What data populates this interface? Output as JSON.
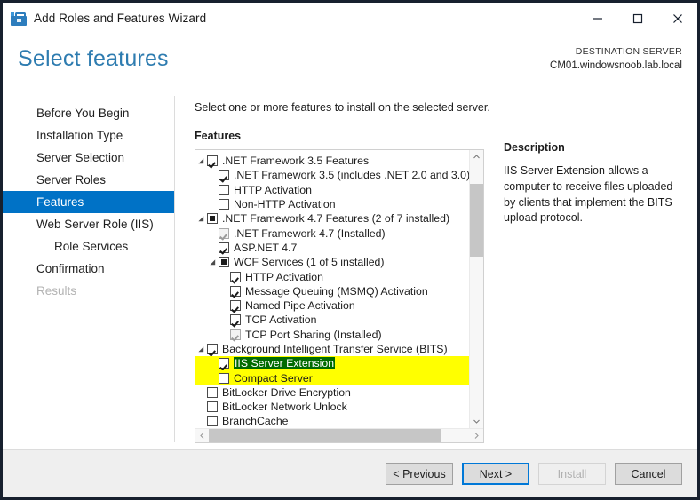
{
  "titlebar": {
    "title": "Add Roles and Features Wizard",
    "icon": "wizard-toolbox-icon",
    "minimize_label": "—",
    "maximize_label": "□",
    "close_label": "✕"
  },
  "header": {
    "page_title": "Select features",
    "destination_label": "DESTINATION SERVER",
    "destination_value": "CM01.windowsnoob.lab.local"
  },
  "nav": {
    "items": [
      {
        "label": "Before You Begin",
        "state": "normal",
        "indent": 0
      },
      {
        "label": "Installation Type",
        "state": "normal",
        "indent": 0
      },
      {
        "label": "Server Selection",
        "state": "normal",
        "indent": 0
      },
      {
        "label": "Server Roles",
        "state": "normal",
        "indent": 0
      },
      {
        "label": "Features",
        "state": "selected",
        "indent": 0
      },
      {
        "label": "Web Server Role (IIS)",
        "state": "normal",
        "indent": 0
      },
      {
        "label": "Role Services",
        "state": "normal",
        "indent": 1
      },
      {
        "label": "Confirmation",
        "state": "normal",
        "indent": 0
      },
      {
        "label": "Results",
        "state": "disabled",
        "indent": 0
      }
    ]
  },
  "main": {
    "instruction": "Select one or more features to install on the selected server.",
    "features_label": "Features",
    "tree": [
      {
        "label": ".NET Framework 3.5 Features",
        "checkbox": "checked",
        "indent": 0,
        "expander": "expanded"
      },
      {
        "label": ".NET Framework 3.5 (includes .NET 2.0 and 3.0)",
        "checkbox": "checked",
        "indent": 1,
        "expander": "none"
      },
      {
        "label": "HTTP Activation",
        "checkbox": "unchecked",
        "indent": 1,
        "expander": "none"
      },
      {
        "label": "Non-HTTP Activation",
        "checkbox": "unchecked",
        "indent": 1,
        "expander": "none"
      },
      {
        "label": ".NET Framework 4.7 Features (2 of 7 installed)",
        "checkbox": "partial",
        "indent": 0,
        "expander": "expanded"
      },
      {
        "label": ".NET Framework 4.7 (Installed)",
        "checkbox": "installed",
        "indent": 1,
        "expander": "none"
      },
      {
        "label": "ASP.NET 4.7",
        "checkbox": "checked",
        "indent": 1,
        "expander": "none"
      },
      {
        "label": "WCF Services (1 of 5 installed)",
        "checkbox": "partial",
        "indent": 1,
        "expander": "expanded"
      },
      {
        "label": "HTTP Activation",
        "checkbox": "checked",
        "indent": 2,
        "expander": "none"
      },
      {
        "label": "Message Queuing (MSMQ) Activation",
        "checkbox": "checked",
        "indent": 2,
        "expander": "none"
      },
      {
        "label": "Named Pipe Activation",
        "checkbox": "checked",
        "indent": 2,
        "expander": "none"
      },
      {
        "label": "TCP Activation",
        "checkbox": "checked",
        "indent": 2,
        "expander": "none"
      },
      {
        "label": "TCP Port Sharing (Installed)",
        "checkbox": "installed",
        "indent": 2,
        "expander": "none"
      },
      {
        "label": "Background Intelligent Transfer Service (BITS)",
        "checkbox": "checked",
        "indent": 0,
        "expander": "expanded"
      },
      {
        "label": "IIS Server Extension",
        "checkbox": "checked",
        "indent": 1,
        "expander": "none",
        "highlight": "yellow",
        "selected": true
      },
      {
        "label": "Compact Server",
        "checkbox": "unchecked",
        "indent": 1,
        "expander": "none",
        "highlight": "yellow"
      },
      {
        "label": "BitLocker Drive Encryption",
        "checkbox": "unchecked",
        "indent": 0,
        "expander": "none"
      },
      {
        "label": "BitLocker Network Unlock",
        "checkbox": "unchecked",
        "indent": 0,
        "expander": "none"
      },
      {
        "label": "BranchCache",
        "checkbox": "unchecked",
        "indent": 0,
        "expander": "none"
      }
    ],
    "scroll_up_icon": "chevron-up-icon",
    "scroll_down_icon": "chevron-down-icon",
    "scroll_left_icon": "chevron-left-icon",
    "scroll_right_icon": "chevron-right-icon"
  },
  "description": {
    "title": "Description",
    "body": "IIS Server Extension allows a computer to receive files uploaded by clients that implement the BITS upload protocol."
  },
  "footer": {
    "previous_label": "< Previous",
    "next_label": "Next >",
    "install_label": "Install",
    "cancel_label": "Cancel"
  },
  "colors": {
    "accent": "#0072c6",
    "title_text": "#2e7cb0",
    "highlight": "#ffff00",
    "selection": "#006b00",
    "window_border": "#17202e",
    "focus_ring": "#0078d7"
  }
}
